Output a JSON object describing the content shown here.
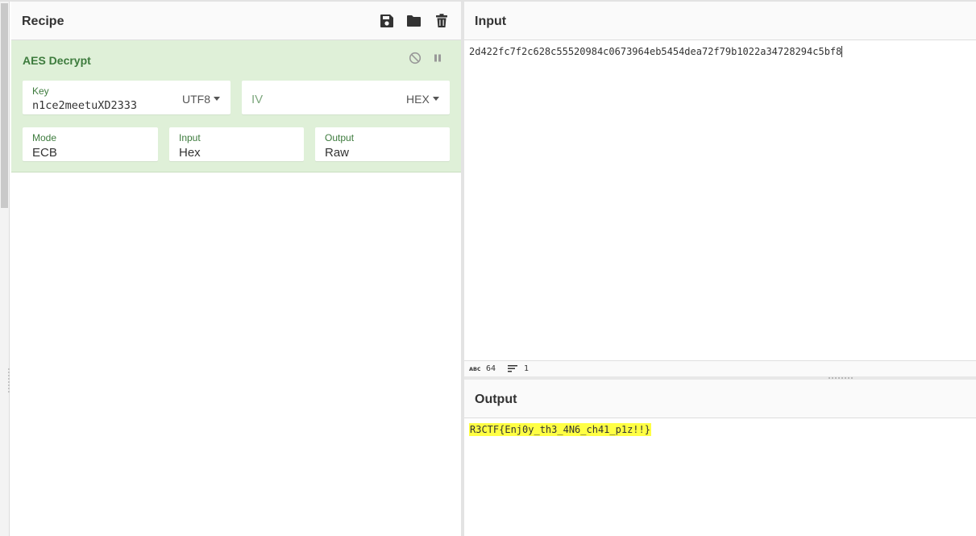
{
  "recipe": {
    "title": "Recipe",
    "icons": [
      "save-icon",
      "folder-open-icon",
      "trash-icon"
    ],
    "operation": {
      "name": "AES Decrypt",
      "controls": [
        "disable-icon",
        "pause-icon"
      ],
      "key": {
        "label": "Key",
        "value": "n1ce2meetuXD2333",
        "encoding": "UTF8"
      },
      "iv": {
        "placeholder": "IV",
        "encoding": "HEX"
      },
      "mode": {
        "label": "Mode",
        "value": "ECB"
      },
      "input": {
        "label": "Input",
        "value": "Hex"
      },
      "output": {
        "label": "Output",
        "value": "Raw"
      }
    }
  },
  "input": {
    "title": "Input",
    "text": "2d422fc7f2c628c55520984c0673964eb5454dea72f79b1022a34728294c5bf8",
    "status": {
      "length": "64",
      "lines": "1"
    }
  },
  "output": {
    "title": "Output",
    "text": "R3CTF{Enj0y_th3_4N6_ch41_p1z!!}"
  },
  "colors": {
    "operation_bg": "#dff0d8",
    "operation_title": "#3d7b3d",
    "highlight": "#ffff44"
  }
}
